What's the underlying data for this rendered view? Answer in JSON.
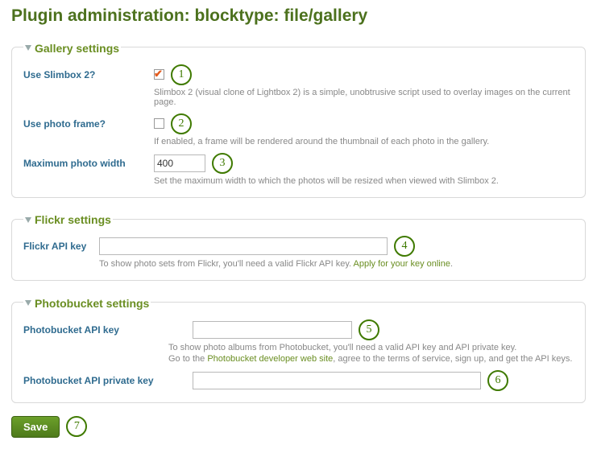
{
  "title": "Plugin administration: blocktype: file/gallery",
  "gallery": {
    "legend": "Gallery settings",
    "slimbox": {
      "label": "Use Slimbox 2?",
      "checked": true,
      "help": "Slimbox 2 (visual clone of Lightbox 2) is a simple, unobtrusive script used to overlay images on the current page.",
      "callout": "1"
    },
    "frame": {
      "label": "Use photo frame?",
      "checked": false,
      "help": "If enabled, a frame will be rendered around the thumbnail of each photo in the gallery.",
      "callout": "2"
    },
    "maxwidth": {
      "label": "Maximum photo width",
      "value": "400",
      "help": "Set the maximum width to which the photos will be resized when viewed with Slimbox 2.",
      "callout": "3"
    }
  },
  "flickr": {
    "legend": "Flickr settings",
    "apikey": {
      "label": "Flickr API key",
      "value": "",
      "help_pre": "To show photo sets from Flickr, you'll need a valid Flickr API key. ",
      "help_link": "Apply for your key online",
      "help_post": ".",
      "callout": "4"
    }
  },
  "pb": {
    "legend": "Photobucket settings",
    "apikey": {
      "label": "Photobucket API key",
      "value": "",
      "help_line1_pre": "To show photo albums from Photobucket, you'll need a valid API key and API private key.",
      "help_line2_pre": "Go to the ",
      "help_line2_link": "Photobucket developer web site",
      "help_line2_post": ", agree to the terms of service, sign up, and get the API keys.",
      "callout": "5"
    },
    "privkey": {
      "label": "Photobucket API private key",
      "value": "",
      "callout": "6"
    }
  },
  "save": {
    "label": "Save",
    "callout": "7"
  }
}
